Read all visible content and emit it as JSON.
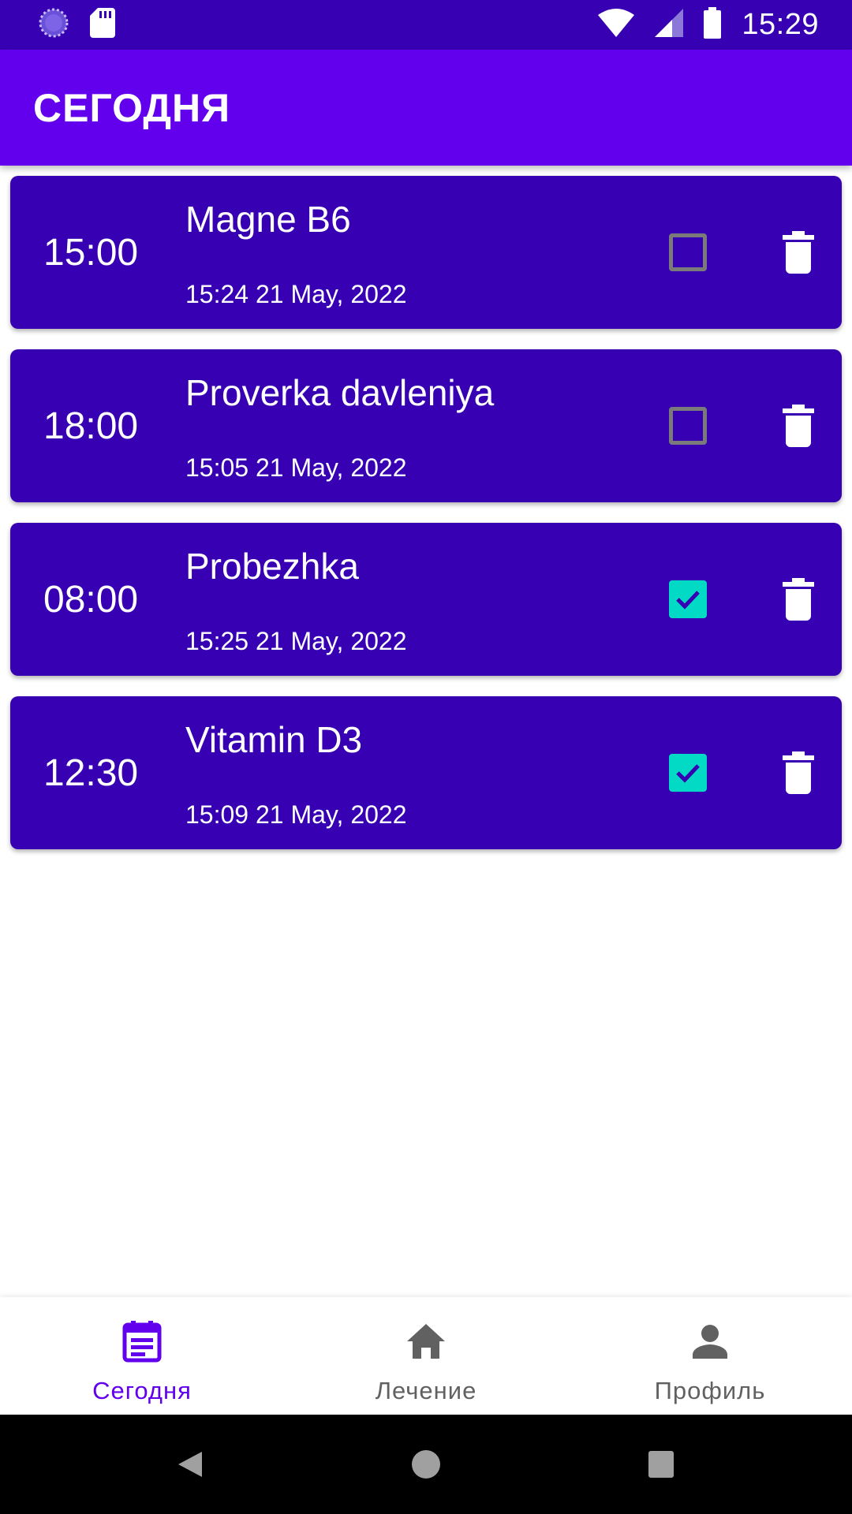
{
  "status_bar": {
    "time": "15:29",
    "icons": [
      "loading-icon",
      "sd-card-icon",
      "wifi-icon",
      "cell-signal-icon",
      "battery-icon"
    ]
  },
  "app_bar": {
    "title": "СЕГОДНЯ"
  },
  "reminders": [
    {
      "time": "15:00",
      "title": "Magne B6",
      "date": "15:24 21 May, 2022",
      "checked": false
    },
    {
      "time": "18:00",
      "title": "Proverka davleniya",
      "date": "15:05 21 May, 2022",
      "checked": false
    },
    {
      "time": "08:00",
      "title": "Probezhka",
      "date": "15:25 21 May, 2022",
      "checked": true
    },
    {
      "time": "12:30",
      "title": "Vitamin D3",
      "date": "15:09 21 May, 2022",
      "checked": true
    }
  ],
  "bottom_nav": {
    "items": [
      {
        "label": "Сегодня",
        "icon": "calendar-icon",
        "active": true
      },
      {
        "label": "Лечение",
        "icon": "home-icon",
        "active": false
      },
      {
        "label": "Профиль",
        "icon": "person-icon",
        "active": false
      }
    ]
  },
  "colors": {
    "primary": "#6200ee",
    "primary_dark": "#3700b3",
    "checkbox_checked": "#03dac5"
  }
}
